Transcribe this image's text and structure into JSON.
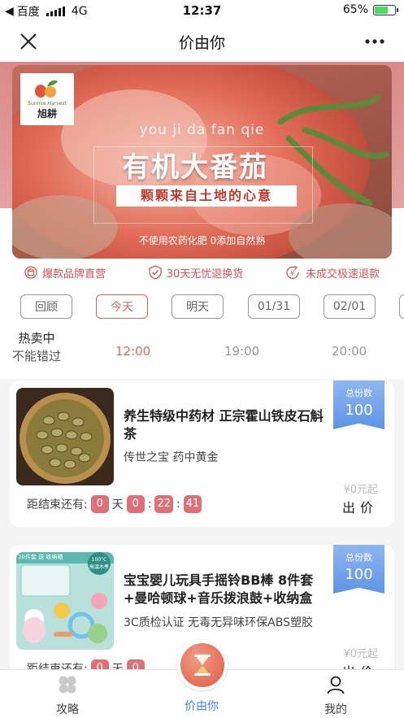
{
  "status_bar": {
    "carrier": "百度",
    "network": "4G",
    "time": "12:37",
    "battery": "65%",
    "battery_level": 0.65
  },
  "nav": {
    "title": "价由你",
    "close_icon": "close-icon",
    "more_icon": "more-icon"
  },
  "banner": {
    "brand_en": "Sunrise Harvest",
    "brand_cn": "旭耕",
    "pinyin": "you ji da fan qie",
    "title": "有机大番茄",
    "subtitle": "颗颗来自土地的心意",
    "footnote": "不使用农药化肥 0添加自然熟"
  },
  "guarantees": [
    {
      "icon": "store-icon",
      "label": "爆款品牌直营"
    },
    {
      "icon": "shield-check-icon",
      "label": "30天无忧退换货"
    },
    {
      "icon": "refund-icon",
      "label": "未成交极速退款"
    }
  ],
  "date_tabs": [
    {
      "label": "回顾",
      "active": false
    },
    {
      "label": "今天",
      "active": true
    },
    {
      "label": "明天",
      "active": false
    },
    {
      "label": "01/31",
      "active": false
    },
    {
      "label": "02/01",
      "active": false
    }
  ],
  "hot": {
    "line1": "热卖中",
    "line2": "不能错过"
  },
  "time_slots": [
    {
      "label": "12:00",
      "active": true
    },
    {
      "label": "19:00",
      "active": false
    },
    {
      "label": "20:00",
      "active": false
    }
  ],
  "products": [
    {
      "name": "养生特级中药材 正宗霍山铁皮石斛茶",
      "desc": "传世之宝 药中黄金",
      "ribbon_label": "总份数",
      "ribbon_num": "100",
      "price": "¥0元起",
      "bid": "出价",
      "countdown_label": "距结束还有:",
      "days": "0",
      "day_unit": "天",
      "hours": "0",
      "minutes": "22",
      "seconds": "41",
      "sep": ":"
    },
    {
      "name": "宝宝婴儿玩具手摇铃BB棒 8件套+曼哈顿球+音乐拨浪鼓+收纳盒",
      "desc": "3C质检认证 无毒无异味环保ABS塑胶",
      "ribbon_label": "总份数",
      "ribbon_num": "100",
      "price": "¥0元起",
      "bid": "出价",
      "countdown_label": "距结束还有:",
      "days": "0",
      "day_unit": "天",
      "hours": "0",
      "thumb_tag": "10件套 送 收纳箱",
      "thumb_badge_top": "100°C",
      "thumb_badge_sub": "高温水煮"
    }
  ],
  "tab_bar": [
    {
      "label": "攻略",
      "icon": "clover-icon",
      "active": false
    },
    {
      "label": "价由你",
      "icon": "hourglass-icon",
      "active": true
    },
    {
      "label": "我的",
      "icon": "user-icon",
      "active": false
    }
  ]
}
